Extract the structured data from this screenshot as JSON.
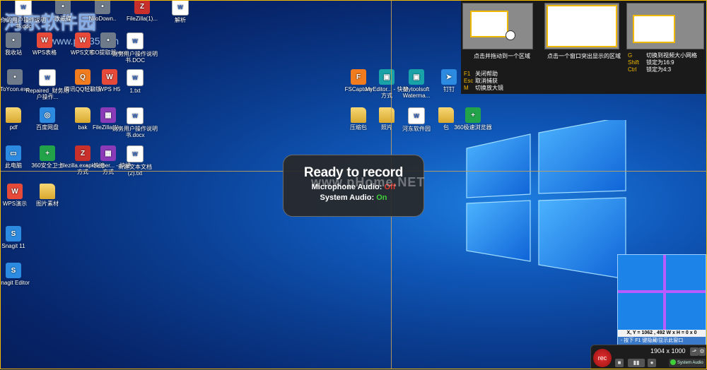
{
  "colors": {
    "accent": "#f0b800",
    "rec_red": "#e23030",
    "status_off": "#e43b2e",
    "status_on": "#3fcf3a",
    "crosshair": "#c9a257"
  },
  "watermark": {
    "line1": "河东软件园",
    "line2": "www.pc0359.cn",
    "overlay": "www.pHome.NET"
  },
  "desktop_icons": [
    {
      "label": "你的用户操作说明书.doc",
      "icon": "document-icon"
    },
    {
      "label": "改磁碟",
      "icon": "shortcut-icon"
    },
    {
      "label": "NiloDown..",
      "icon": "download-icon"
    },
    {
      "label": "FileZilla(1)...",
      "icon": "filezilla-icon"
    },
    {
      "label": "解析",
      "icon": "document-icon"
    },
    {
      "label": "我收站",
      "icon": "recycle-bin-icon"
    },
    {
      "label": "WPS表格",
      "icon": "wps-sheet-icon"
    },
    {
      "label": "WPS文字",
      "icon": "wps-writer-icon"
    },
    {
      "label": "ICO提取器.exe",
      "icon": "ico-extractor-icon"
    },
    {
      "label": "财务用户操作说明书.DOC",
      "icon": "document-icon"
    },
    {
      "label": "ToYcon.exe",
      "icon": "toycon-icon"
    },
    {
      "label": "Repaired_财务用户操作...",
      "icon": "document-icon"
    },
    {
      "label": "腾讯QQ轻聊版",
      "icon": "qq-icon"
    },
    {
      "label": "WPS H5",
      "icon": "wps-h5-icon"
    },
    {
      "label": "1.txt",
      "icon": "text-file-icon"
    },
    {
      "label": "pdf",
      "icon": "folder-icon"
    },
    {
      "label": "百度网盘",
      "icon": "baidu-netdisk-icon"
    },
    {
      "label": "bak",
      "icon": "folder-icon"
    },
    {
      "label": "FileZilla(1)...",
      "icon": "archive-icon"
    },
    {
      "label": "财务用户操作说明书.docx",
      "icon": "document-icon"
    },
    {
      "label": "此电脑",
      "icon": "computer-icon"
    },
    {
      "label": "360安全卫士",
      "icon": "360-security-icon"
    },
    {
      "label": "filezilla.exe - 快捷方式",
      "icon": "filezilla-icon"
    },
    {
      "label": "apkhelper... - 快捷方式",
      "icon": "apk-helper-icon"
    },
    {
      "label": "新建文本文档(2).txt",
      "icon": "text-file-icon"
    },
    {
      "label": "WPS演示",
      "icon": "wps-presentation-icon"
    },
    {
      "label": "图片素材",
      "icon": "folder-icon"
    },
    {
      "label": "Snagit 11",
      "icon": "snagit-icon"
    },
    {
      "label": "Snagit Editor",
      "icon": "snagit-editor-icon"
    },
    {
      "label": "FSCapture",
      "icon": "fscapture-icon"
    },
    {
      "label": "MyEditor... - 快捷方式",
      "icon": "myeditor-icon"
    },
    {
      "label": "Mytoolsoft Waterma...",
      "icon": "image-icon"
    },
    {
      "label": "钉钉",
      "icon": "dingtalk-icon"
    },
    {
      "label": "压缩包",
      "icon": "folder-icon"
    },
    {
      "label": "照片",
      "icon": "folder-icon"
    },
    {
      "label": "河东软件园",
      "icon": "document-icon"
    },
    {
      "label": "包",
      "icon": "folder-icon"
    },
    {
      "label": "360极速浏览器",
      "icon": "360-browser-icon"
    }
  ],
  "help_panel": {
    "caption1": "点击并拖动到一个区域",
    "caption2": "点击一个窗口突出显示的区域",
    "keys_left": [
      {
        "key": "F1",
        "text": "关闭帮助"
      },
      {
        "key": "Esc",
        "text": "取消捕获"
      },
      {
        "key": "M",
        "text": "切换放大镜"
      }
    ],
    "keys_right": [
      {
        "key": "G",
        "text": "切换到视频大小网格"
      },
      {
        "key": "Shift",
        "text": "锁定为16:9"
      },
      {
        "key": "Ctrl",
        "text": "锁定为4:3"
      }
    ]
  },
  "ready": {
    "title": "Ready to record",
    "mic_label": "Microphone Audio:",
    "mic_state": "Off",
    "sys_label": "System Audio:",
    "sys_state": "On"
  },
  "magnifier": {
    "coords": "X, Y = 1062 , 492     W x H = 0 x 0",
    "tip": "- 按下 F1 键隐藏/显示此窗口"
  },
  "recorder": {
    "rec_label": "rec",
    "dimensions": "1904 x 1000",
    "system_audio": "System Audio"
  }
}
